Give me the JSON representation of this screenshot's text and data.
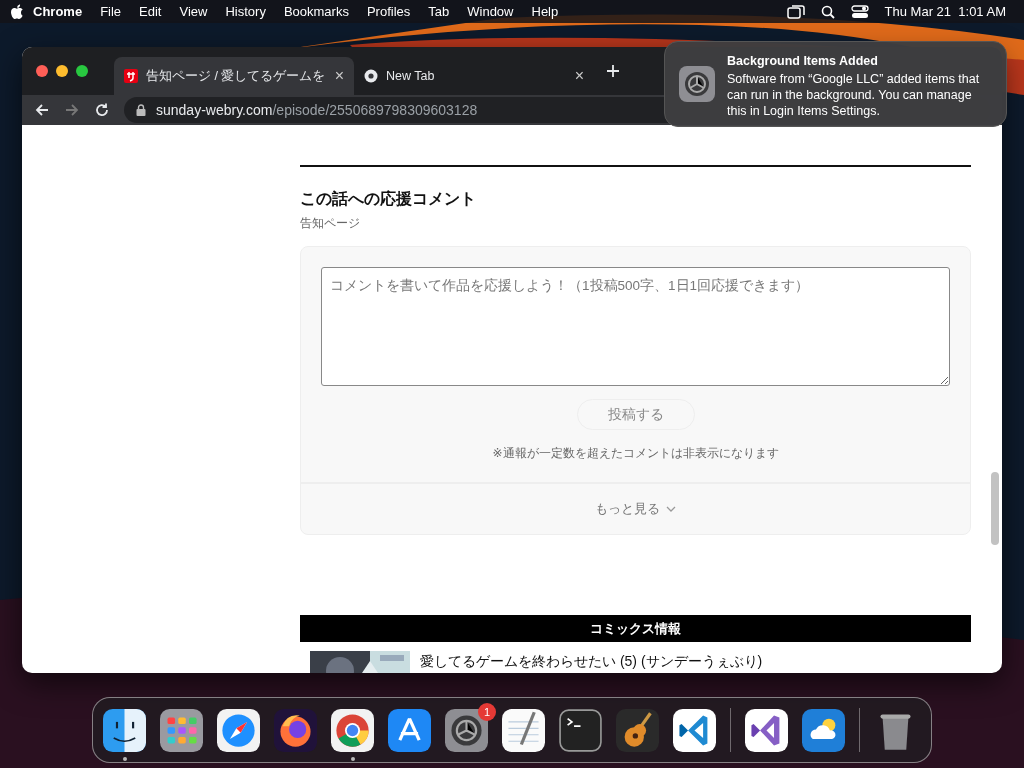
{
  "menubar": {
    "app": "Chrome",
    "items": [
      "File",
      "Edit",
      "View",
      "History",
      "Bookmarks",
      "Profiles",
      "Tab",
      "Window",
      "Help"
    ],
    "clock": "Thu Mar 21  1:01 AM"
  },
  "browser": {
    "tabs": [
      {
        "title": "告知ページ / 愛してるゲームを",
        "selected": true,
        "kind": "site",
        "close": "×"
      },
      {
        "title": "New Tab",
        "selected": false,
        "kind": "chrome",
        "close": "×"
      }
    ],
    "url": {
      "host": "sunday-webry.com",
      "path": "/episode/2550689798309603128"
    }
  },
  "notification": {
    "title": "Background Items Added",
    "body": "Software from “Google LLC” added items that can run in the background. You can manage this in Login Items Settings."
  },
  "page": {
    "section_title": "この話への応援コメント",
    "section_subtitle": "告知ページ",
    "comment_placeholder": "コメントを書いて作品を応援しよう！（1投稿500字、1日1回応援できます）",
    "submit_button": "投稿する",
    "note": "※通報が一定数を超えたコメントは非表示になります",
    "more_link": "もっと見る",
    "comics_header": "コミックス情報",
    "comics": [
      {
        "title": "愛してるゲームを終わらせたい (5) (サンデーうぇぶり)"
      }
    ]
  },
  "dock": [
    {
      "kind": "finder",
      "running": true
    },
    {
      "kind": "launchpad",
      "running": false
    },
    {
      "kind": "safari",
      "running": false
    },
    {
      "kind": "firefox",
      "running": false
    },
    {
      "kind": "chrome",
      "running": true
    },
    {
      "kind": "appstore",
      "running": false
    },
    {
      "kind": "settings",
      "running": false,
      "badge": "1"
    },
    {
      "kind": "textedit",
      "running": false
    },
    {
      "kind": "terminal",
      "running": false
    },
    {
      "kind": "guitar",
      "running": false
    },
    {
      "kind": "vscode",
      "running": false
    },
    {
      "kind": "separator"
    },
    {
      "kind": "visualstudio",
      "running": false
    },
    {
      "kind": "weather",
      "running": false
    },
    {
      "kind": "separator"
    },
    {
      "kind": "trash",
      "running": false
    }
  ]
}
